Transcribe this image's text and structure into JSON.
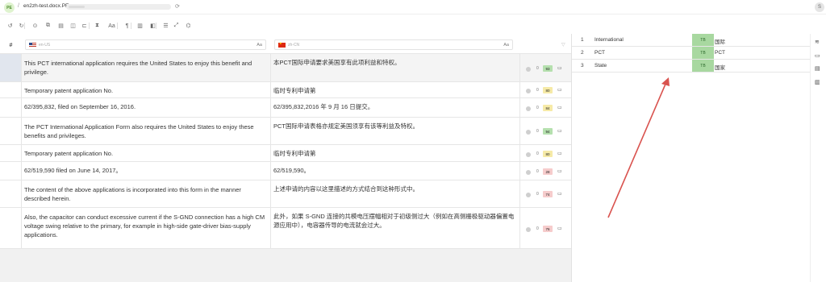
{
  "app": {
    "logo_text": "PE",
    "breadcrumb_separator": "/",
    "document_title": "en2zh-test.docx.PE",
    "refresh_icon": "refresh-icon",
    "user_initial": "S"
  },
  "toolbar": {
    "icons": [
      "undo-icon",
      "redo-icon",
      "confirm-icon",
      "copy-source-icon",
      "clear-icon",
      "tag-icon",
      "tag-next-icon",
      "insert-icon",
      "font-case-icon",
      "paragraph-icon",
      "qa-icon",
      "review-icon",
      "filter-list-icon",
      "fullscreen-icon",
      "view-icon"
    ],
    "glyphs": [
      "↺",
      "↻",
      "⊙",
      "⧉",
      "▤",
      "◫",
      "⊏",
      "⧗",
      "Aa",
      "¶",
      "▥",
      "◧",
      "☰",
      "⤢",
      "⌬"
    ]
  },
  "grid": {
    "hash_label": "#",
    "source_lang": "en-US",
    "target_lang": "zh-CN",
    "case_label": "Aa",
    "filter_icon": "filter-icon",
    "rows": [
      {
        "source": "This PCT international application requires the United States to enjoy this benefit and privilege.",
        "target": "本PCT国际申请要求美国享有此项利益和特权。",
        "count": "0",
        "score": "93",
        "score_color": "#b5e0ae"
      },
      {
        "source": "Temporary patent application No.",
        "target": "临时专利申请第",
        "count": "0",
        "score": "80",
        "score_color": "#f6eaa7"
      },
      {
        "source": "62/395,832, filed on September 16, 2016.",
        "target": "62/395,832,2016 年 9 月 16 日提交。",
        "count": "0",
        "score": "84",
        "score_color": "#f6eaa7"
      },
      {
        "source": "The PCT International Application Form also requires the United States to enjoy these benefits and privileges.",
        "target": "PCT国际申请表格亦规定美国须享有该等利益及特权。",
        "count": "0",
        "score": "94",
        "score_color": "#b5e0ae"
      },
      {
        "source": "Temporary patent application No.",
        "target": "临时专利申请第",
        "count": "0",
        "score": "80",
        "score_color": "#f6eaa7"
      },
      {
        "source": "62/519,590 filed on June 14, 2017。",
        "target": "62/519,590。",
        "count": "0",
        "score": "28",
        "score_color": "#f6cccc"
      },
      {
        "source": "The content of the above applications is incorporated into this form in the manner described herein.",
        "target": "上述申请的内容以这里描述的方式结合到这种形式中。",
        "count": "0",
        "score": "74",
        "score_color": "#f6cccc"
      },
      {
        "source": "Also, the capacitor can conduct excessive current if the S-GND connection has a high CM voltage swing relative to the primary, for example in high-side gate-driver bias-supply applications.",
        "target": "此外，如果 S-GND 连接的共模电压摆幅相对于初级侧过大（例如在高侧栅极驱动器偏置电源应用中），电容器传导的电流就会过大。",
        "count": "0",
        "score": "76",
        "score_color": "#f6cccc"
      }
    ]
  },
  "termbase": {
    "tag": "TB",
    "entries": [
      {
        "n": "1",
        "en": "International",
        "zh": "国际"
      },
      {
        "n": "2",
        "en": "PCT",
        "zh": "PCT"
      },
      {
        "n": "3",
        "en": "State",
        "zh": "国家"
      }
    ]
  },
  "right_rail": {
    "icons": [
      "layers-icon",
      "comments-icon",
      "doc-search-icon",
      "doc-info-icon"
    ],
    "glyphs": [
      "≋",
      "▭",
      "▤",
      "▥"
    ]
  },
  "annotation": {
    "arrow_color": "#d9534f"
  }
}
